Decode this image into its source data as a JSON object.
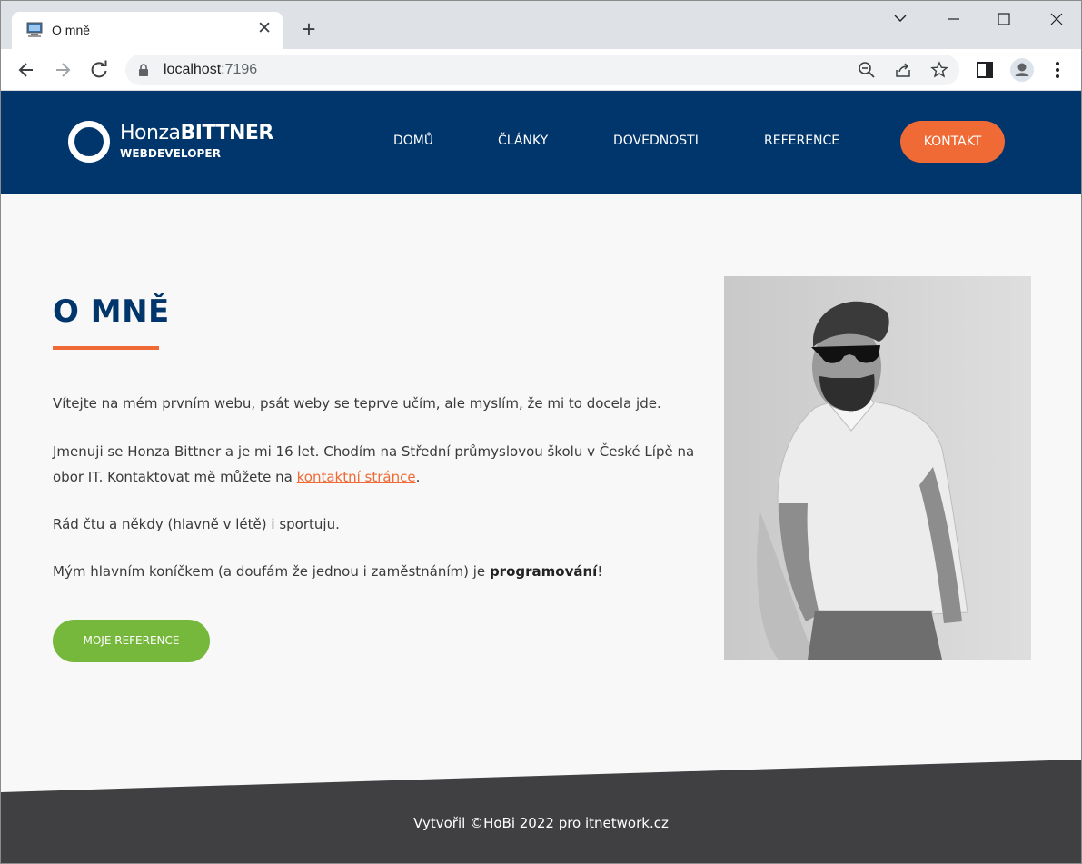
{
  "browser": {
    "tab_title": "O mně",
    "tab_close": "✕",
    "new_tab": "+",
    "url_host": "localhost",
    "url_port": ":7196",
    "window_controls": [
      "chevron-down-icon",
      "minimize-icon",
      "maximize-icon",
      "close-icon"
    ]
  },
  "site": {
    "logo_name_light": "Honza",
    "logo_name_bold": "BITTNER",
    "logo_sub": "WEBDEVELOPER",
    "nav": [
      "DOMŮ",
      "ČLÁNKY",
      "DOVEDNOSTI",
      "REFERENCE"
    ],
    "nav_cta": "KONTAKT",
    "colors": {
      "header": "#00366b",
      "accent": "#f06a35",
      "button_green": "#76b83b",
      "footer": "#404042"
    }
  },
  "page": {
    "title": "O MNĚ",
    "para1": "Vítejte na mém prvním webu, psát weby se teprve učím, ale myslím, že mi to docela jde.",
    "para2_before": "Jmenuji se Honza Bittner a je mi 16 let. Chodím na Střední průmyslovou školu v České Lípě na obor IT. Kontaktovat mě můžete na ",
    "para2_link": "kontaktní stránce",
    "para2_after": ".",
    "para3": "Rád čtu a někdy (hlavně v létě) i sportuju.",
    "para4_before": "Mým hlavním koníčkem (a doufám že jednou i zaměstnáním) je ",
    "para4_bold": "programování",
    "para4_after": "!",
    "button": "MOJE REFERENCE"
  },
  "footer": {
    "text": "Vytvořil ©HoBi 2022 pro itnetwork.cz"
  }
}
